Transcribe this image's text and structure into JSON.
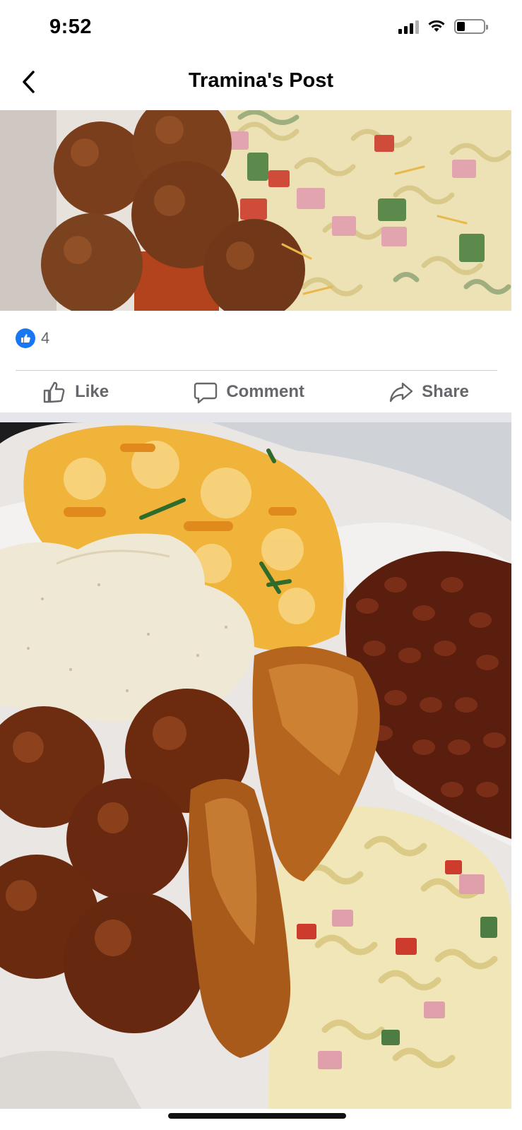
{
  "status_bar": {
    "time": "9:52",
    "icons": [
      "cellular-signal-icon",
      "wifi-icon",
      "battery-icon"
    ],
    "battery_level": 0.3
  },
  "header": {
    "title": "Tramina's Post",
    "back_icon": "chevron-left-icon"
  },
  "post": {
    "reaction_icon": "like-reaction-icon",
    "reaction_count": "4",
    "actions": [
      {
        "label": "Like",
        "icon": "thumbs-up-outline-icon"
      },
      {
        "label": "Comment",
        "icon": "speech-bubble-icon"
      },
      {
        "label": "Share",
        "icon": "share-arrow-icon"
      }
    ]
  },
  "colors": {
    "facebook_blue": "#1877f2",
    "secondary_text": "#65676b",
    "divider": "#ced0d4",
    "section_gap": "#e4e6eb"
  }
}
